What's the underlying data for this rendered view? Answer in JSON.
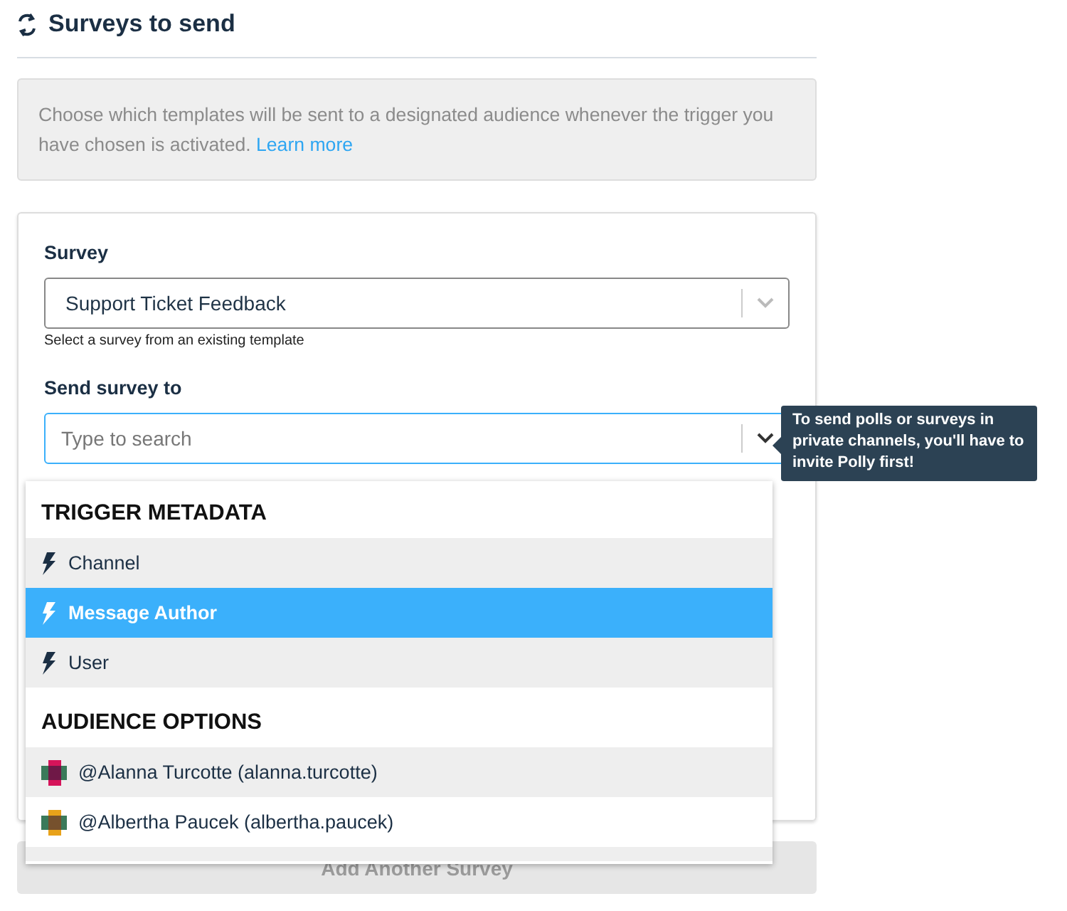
{
  "header": {
    "title": "Surveys to send"
  },
  "info": {
    "text": "Choose which templates will be sent to a designated audience whenever the trigger you have chosen is activated.",
    "link": "Learn more"
  },
  "survey_field": {
    "label": "Survey",
    "value": "Support Ticket Feedback",
    "help": "Select a survey from an existing template"
  },
  "send_to_field": {
    "label": "Send survey to",
    "placeholder": "Type to search",
    "focused": true
  },
  "tooltip": {
    "text": "To send polls or surveys in private channels, you'll have to invite Polly first!"
  },
  "dropdown": {
    "groups": [
      {
        "heading": "TRIGGER METADATA",
        "items": [
          {
            "kind": "trigger",
            "label": "Channel",
            "selected": false,
            "shaded": true
          },
          {
            "kind": "trigger",
            "label": "Message Author",
            "selected": true,
            "shaded": true
          },
          {
            "kind": "trigger",
            "label": "User",
            "selected": false,
            "shaded": true
          }
        ]
      },
      {
        "heading": "AUDIENCE OPTIONS",
        "items": [
          {
            "kind": "user",
            "label": "@Alanna Turcotte (alanna.turcotte)",
            "selected": false,
            "shaded": true,
            "color": "#d6145a"
          },
          {
            "kind": "user",
            "label": "@Albertha Paucek (albertha.paucek)",
            "selected": false,
            "shaded": false,
            "color": "#e8a21a"
          }
        ]
      }
    ]
  },
  "add_button": {
    "label": "Add Another Survey",
    "disabled": true
  }
}
